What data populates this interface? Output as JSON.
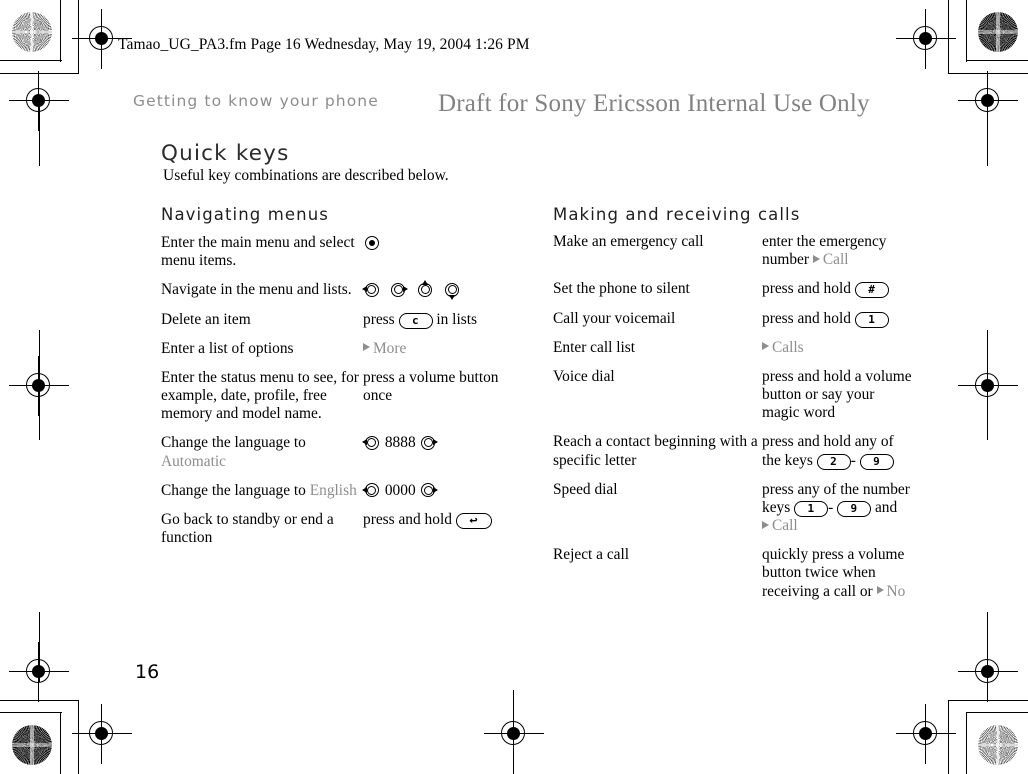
{
  "print_info": {
    "filename_line": "Tamao_UG_PA3.fm  Page 16  Wednesday, May 19, 2004  1:26 PM"
  },
  "header": {
    "running_head": "Getting to know your phone",
    "draft_banner": "Draft for Sony Ericsson Internal Use Only"
  },
  "footer": {
    "page_number": "16"
  },
  "chapter": {
    "title": "Quick keys",
    "intro": "Useful key combinations are described below."
  },
  "colors": {
    "soft_key_gray": "#8e8e8e",
    "running_head_gray": "#8d8d8d",
    "draft_banner_gray": "#828282",
    "text_black": "#000000"
  },
  "left_column": {
    "section_title": "Navigating menus",
    "rows": [
      {
        "action": "Enter the main menu and select menu items.",
        "how_kind": "icon-select",
        "how_text": ""
      },
      {
        "action": "Navigate in the menu and lists.",
        "how_kind": "icon-navgroup",
        "how_text": ""
      },
      {
        "action": "Delete an item",
        "how_kind": "press-key",
        "how_prefix": "press",
        "key": "c",
        "how_suffix": "in lists"
      },
      {
        "action": "Enter a list of options",
        "how_kind": "softkey",
        "softkey_label": "More"
      },
      {
        "action": "Enter the status menu to see, for example, date, profile, free memory and model name.",
        "how_kind": "text",
        "how_text": "press a volume button once"
      },
      {
        "action_prefix": "Change the language to ",
        "action_gray": "Automatic",
        "how_kind": "icon-code",
        "code": "8888"
      },
      {
        "action_prefix": "Change the language to ",
        "action_gray": "English",
        "how_kind": "icon-code",
        "code": "0000"
      },
      {
        "action": "Go back to standby or end a function",
        "how_kind": "press-hold-backkey",
        "how_prefix": "press and hold",
        "key": "back"
      }
    ]
  },
  "right_column": {
    "section_title": "Making and receiving calls",
    "rows": [
      {
        "action": "Make an emergency call",
        "how_kind": "text-softkey",
        "how_text": "enter the emergency number ",
        "softkey_label": "Call"
      },
      {
        "action": "Set the phone to silent",
        "how_kind": "press-key",
        "how_prefix": "press and hold",
        "key": "#",
        "how_suffix": ""
      },
      {
        "action": "Call your voicemail",
        "how_kind": "press-key",
        "how_prefix": "press and hold",
        "key": "1",
        "how_suffix": ""
      },
      {
        "action": "Enter call list",
        "how_kind": "softkey",
        "softkey_label": "Calls"
      },
      {
        "action": "Voice dial",
        "how_kind": "text",
        "how_text": "press and hold a volume button or say your magic word"
      },
      {
        "action": "Reach a contact beginning with a specific letter",
        "how_kind": "key-range",
        "how_prefix": "press and hold any of the keys",
        "key_from": "2",
        "key_to": "9",
        "range_separator": "-"
      },
      {
        "action": "Speed dial",
        "how_kind": "key-range-softkey",
        "how_prefix": "press any of the number keys",
        "key_from": "1",
        "key_to": "9",
        "range_separator": "-",
        "conjunction": "and",
        "softkey_label": "Call"
      },
      {
        "action": "Reject a call",
        "how_kind": "text-softkey",
        "how_text": "quickly press a volume button twice when receiving a call or ",
        "softkey_label": "No"
      }
    ]
  },
  "icons": {
    "select_key": "select-joystick-icon",
    "nav_left": "navigate-left-icon",
    "nav_right": "navigate-right-icon",
    "nav_up": "navigate-up-icon",
    "nav_down": "navigate-down-icon",
    "back_key_glyph": "↰"
  }
}
